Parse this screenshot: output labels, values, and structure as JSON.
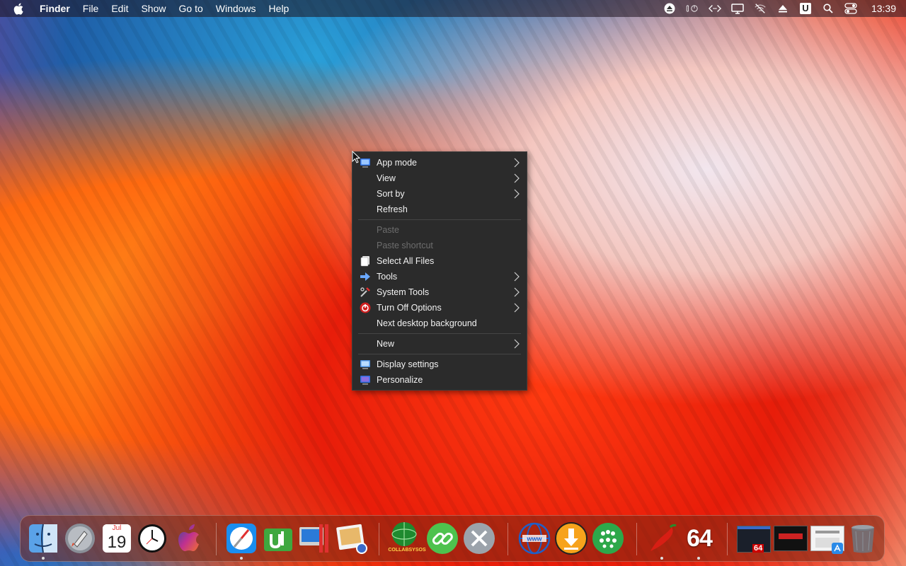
{
  "menubar": {
    "app_name": "Finder",
    "items": [
      "File",
      "Edit",
      "Show",
      "Go to",
      "Windows",
      "Help"
    ],
    "status_icons": [
      "eject-icon",
      "power-status-icon",
      "code-icon",
      "display-icon",
      "wifi-off-icon",
      "eject-alt-icon",
      "u-app-icon",
      "search-icon",
      "control-center-icon"
    ],
    "u_label": "U",
    "clock": "13:39"
  },
  "context_menu": {
    "groups": [
      [
        {
          "label": "App mode",
          "icon": "monitor-icon",
          "submenu": true,
          "enabled": true
        },
        {
          "label": "View",
          "icon": "",
          "submenu": true,
          "enabled": true
        },
        {
          "label": "Sort by",
          "icon": "",
          "submenu": true,
          "enabled": true
        },
        {
          "label": "Refresh",
          "icon": "",
          "submenu": false,
          "enabled": true
        }
      ],
      [
        {
          "label": "Paste",
          "icon": "",
          "submenu": false,
          "enabled": false
        },
        {
          "label": "Paste shortcut",
          "icon": "",
          "submenu": false,
          "enabled": false
        },
        {
          "label": "Select All Files",
          "icon": "files-icon",
          "submenu": false,
          "enabled": true
        },
        {
          "label": "Tools",
          "icon": "tools-arrow-icon",
          "submenu": true,
          "enabled": true
        },
        {
          "label": "System Tools",
          "icon": "system-tools-icon",
          "submenu": true,
          "enabled": true
        },
        {
          "label": "Turn Off Options",
          "icon": "power-icon",
          "submenu": true,
          "enabled": true
        },
        {
          "label": "Next desktop background",
          "icon": "",
          "submenu": false,
          "enabled": true
        }
      ],
      [
        {
          "label": "New",
          "icon": "",
          "submenu": true,
          "enabled": true
        }
      ],
      [
        {
          "label": "Display settings",
          "icon": "display-settings-icon",
          "submenu": false,
          "enabled": true
        },
        {
          "label": "Personalize",
          "icon": "personalize-icon",
          "submenu": false,
          "enabled": true
        }
      ]
    ]
  },
  "dock": {
    "calendar_month": "Jul",
    "calendar_day": "19",
    "collabsysos_label": "COLLABSYSOS",
    "big64_label": "64",
    "badge64_label": "64"
  },
  "colors": {
    "menu_bg": "#2b2b2b",
    "menu_text": "#f2f2f2",
    "menu_disabled": "#6d6d6d"
  }
}
